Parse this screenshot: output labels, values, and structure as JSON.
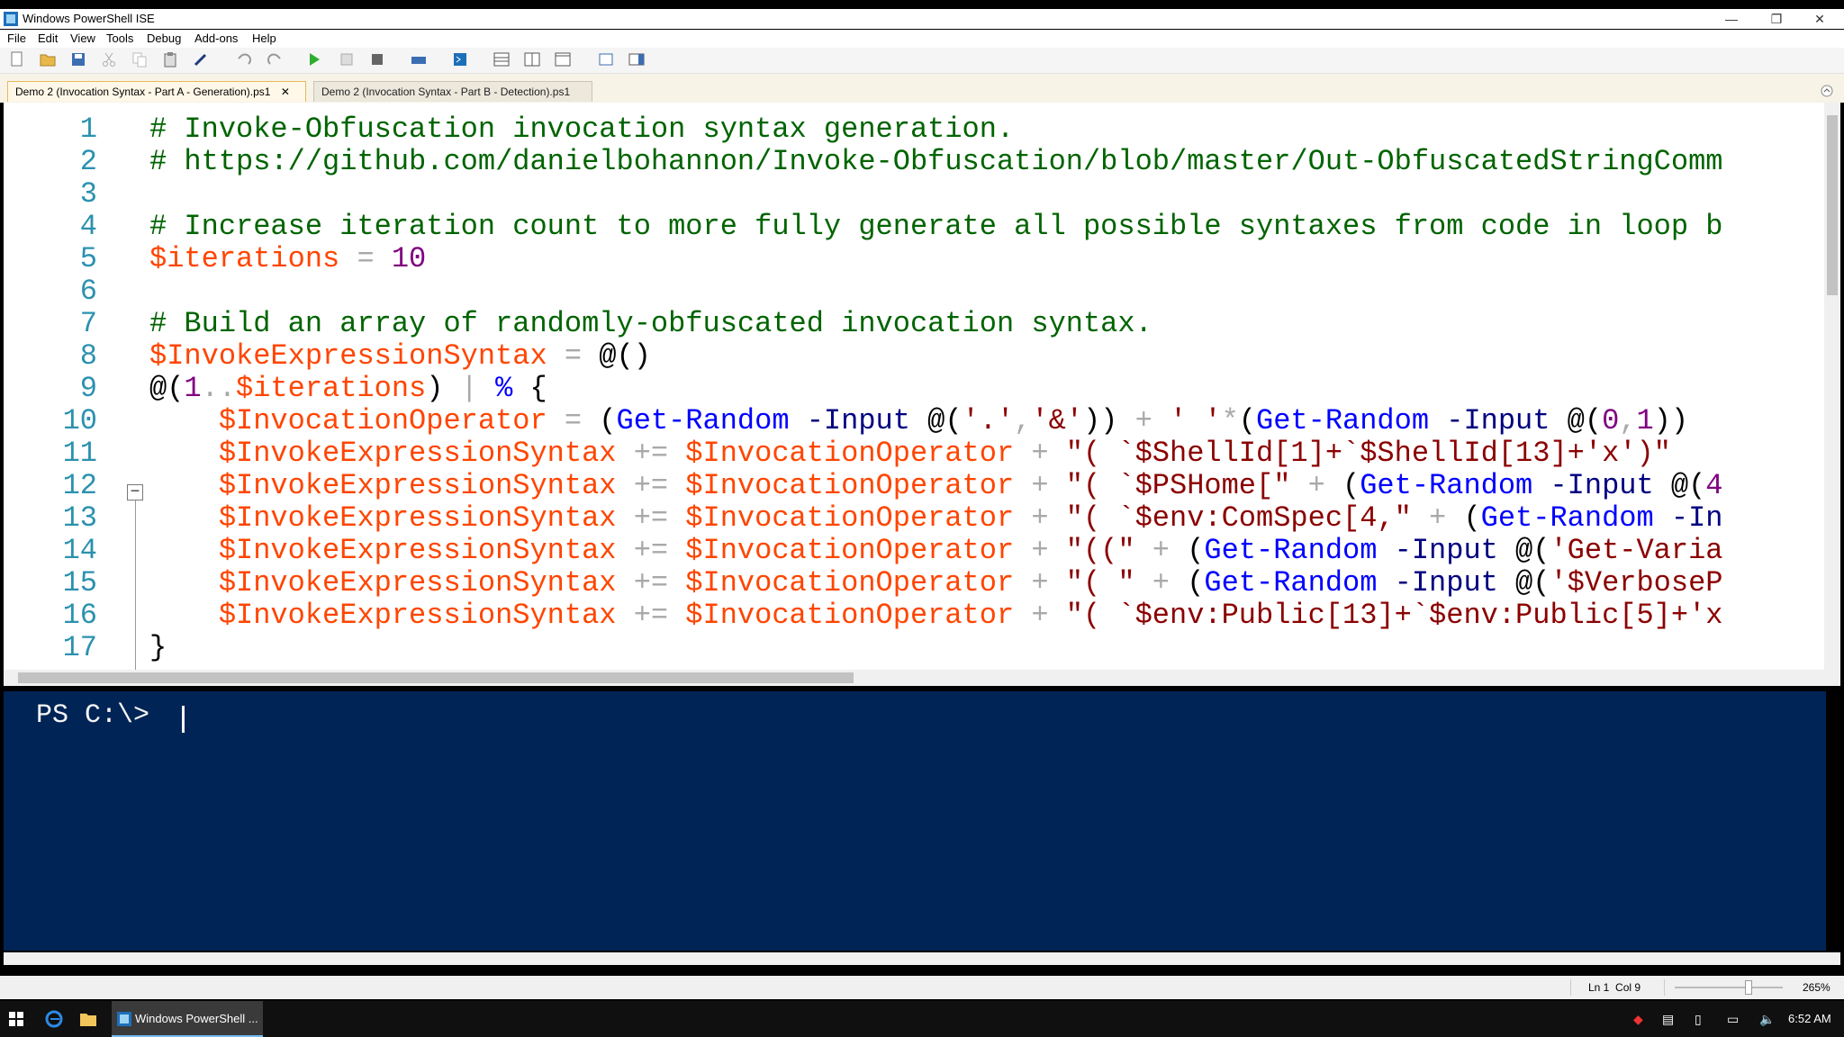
{
  "window": {
    "title": "Windows PowerShell ISE"
  },
  "menu": [
    "File",
    "Edit",
    "View",
    "Tools",
    "Debug",
    "Add-ons",
    "Help"
  ],
  "tabs": [
    {
      "label": "Demo 2 (Invocation Syntax - Part A - Generation).ps1",
      "close": "✕",
      "active": true
    },
    {
      "label": "Demo 2 (Invocation Syntax - Part B - Detection).ps1",
      "active": false
    }
  ],
  "editor": {
    "line_numbers": [
      "1",
      "2",
      "3",
      "4",
      "5",
      "6",
      "7",
      "8",
      "9",
      "10",
      "11",
      "12",
      "13",
      "14",
      "15",
      "16",
      "17"
    ],
    "lines": [
      {
        "tokens": [
          {
            "t": "# Invoke-Obfuscation invocation syntax generation.",
            "c": "cm"
          }
        ]
      },
      {
        "tokens": [
          {
            "t": "# https://github.com/danielbohannon/Invoke-Obfuscation/blob/master/Out-ObfuscatedStringComm",
            "c": "cm"
          }
        ]
      },
      {
        "tokens": []
      },
      {
        "tokens": [
          {
            "t": "# Increase iteration count to more fully generate all possible syntaxes from code in loop b",
            "c": "cm"
          }
        ]
      },
      {
        "tokens": [
          {
            "t": "$iterations",
            "c": "vr"
          },
          {
            "t": " = ",
            "c": "op"
          },
          {
            "t": "10",
            "c": "nm"
          }
        ]
      },
      {
        "tokens": []
      },
      {
        "tokens": [
          {
            "t": "# Build an array of randomly-obfuscated invocation syntax.",
            "c": "cm"
          }
        ]
      },
      {
        "tokens": [
          {
            "t": "$InvokeExpressionSyntax",
            "c": "vr"
          },
          {
            "t": " = ",
            "c": "op"
          },
          {
            "t": "@()",
            "c": ""
          }
        ]
      },
      {
        "tokens": [
          {
            "t": "@(",
            "c": ""
          },
          {
            "t": "1",
            "c": "nm"
          },
          {
            "t": "..",
            "c": "op"
          },
          {
            "t": "$iterations",
            "c": "vr"
          },
          {
            "t": ")",
            "c": ""
          },
          {
            "t": " | ",
            "c": "op"
          },
          {
            "t": "%",
            "c": "cmd"
          },
          {
            "t": " {",
            "c": ""
          }
        ]
      },
      {
        "tokens": [
          {
            "t": "    $InvocationOperator",
            "c": "vr"
          },
          {
            "t": " = ",
            "c": "op"
          },
          {
            "t": "(",
            "c": ""
          },
          {
            "t": "Get-Random",
            "c": "cmd"
          },
          {
            "t": " -Input",
            "c": "prm"
          },
          {
            "t": " @(",
            "c": ""
          },
          {
            "t": "'.'",
            "c": "str"
          },
          {
            "t": ",",
            "c": "op"
          },
          {
            "t": "'&'",
            "c": "str"
          },
          {
            "t": ")) ",
            "c": ""
          },
          {
            "t": "+ ",
            "c": "op"
          },
          {
            "t": "' '",
            "c": "str"
          },
          {
            "t": "*",
            "c": "op"
          },
          {
            "t": "(",
            "c": ""
          },
          {
            "t": "Get-Random",
            "c": "cmd"
          },
          {
            "t": " -Input",
            "c": "prm"
          },
          {
            "t": " @(",
            "c": ""
          },
          {
            "t": "0",
            "c": "nm"
          },
          {
            "t": ",",
            "c": "op"
          },
          {
            "t": "1",
            "c": "nm"
          },
          {
            "t": "))",
            "c": ""
          }
        ]
      },
      {
        "tokens": [
          {
            "t": "    $InvokeExpressionSyntax",
            "c": "vr"
          },
          {
            "t": " += ",
            "c": "op"
          },
          {
            "t": "$InvocationOperator",
            "c": "vr"
          },
          {
            "t": " + ",
            "c": "op"
          },
          {
            "t": "\"( `$ShellId[1]+`$ShellId[13]+'x')\"",
            "c": "str"
          }
        ]
      },
      {
        "tokens": [
          {
            "t": "    $InvokeExpressionSyntax",
            "c": "vr"
          },
          {
            "t": " += ",
            "c": "op"
          },
          {
            "t": "$InvocationOperator",
            "c": "vr"
          },
          {
            "t": " + ",
            "c": "op"
          },
          {
            "t": "\"( `$PSHome[\"",
            "c": "str"
          },
          {
            "t": " + ",
            "c": "op"
          },
          {
            "t": "(",
            "c": ""
          },
          {
            "t": "Get-Random",
            "c": "cmd"
          },
          {
            "t": " -Input",
            "c": "prm"
          },
          {
            "t": " @(",
            "c": ""
          },
          {
            "t": "4",
            "c": "nm"
          }
        ]
      },
      {
        "tokens": [
          {
            "t": "    $InvokeExpressionSyntax",
            "c": "vr"
          },
          {
            "t": " += ",
            "c": "op"
          },
          {
            "t": "$InvocationOperator",
            "c": "vr"
          },
          {
            "t": " + ",
            "c": "op"
          },
          {
            "t": "\"( `$env:ComSpec[4,\"",
            "c": "str"
          },
          {
            "t": " + ",
            "c": "op"
          },
          {
            "t": "(",
            "c": ""
          },
          {
            "t": "Get-Random",
            "c": "cmd"
          },
          {
            "t": " -In",
            "c": "prm"
          }
        ]
      },
      {
        "tokens": [
          {
            "t": "    $InvokeExpressionSyntax",
            "c": "vr"
          },
          {
            "t": " += ",
            "c": "op"
          },
          {
            "t": "$InvocationOperator",
            "c": "vr"
          },
          {
            "t": " + ",
            "c": "op"
          },
          {
            "t": "\"((\"",
            "c": "str"
          },
          {
            "t": " + ",
            "c": "op"
          },
          {
            "t": "(",
            "c": ""
          },
          {
            "t": "Get-Random",
            "c": "cmd"
          },
          {
            "t": " -Input",
            "c": "prm"
          },
          {
            "t": " @(",
            "c": ""
          },
          {
            "t": "'Get-Varia",
            "c": "str"
          }
        ]
      },
      {
        "tokens": [
          {
            "t": "    $InvokeExpressionSyntax",
            "c": "vr"
          },
          {
            "t": " += ",
            "c": "op"
          },
          {
            "t": "$InvocationOperator",
            "c": "vr"
          },
          {
            "t": " + ",
            "c": "op"
          },
          {
            "t": "\"( \"",
            "c": "str"
          },
          {
            "t": " + ",
            "c": "op"
          },
          {
            "t": "(",
            "c": ""
          },
          {
            "t": "Get-Random",
            "c": "cmd"
          },
          {
            "t": " -Input",
            "c": "prm"
          },
          {
            "t": " @(",
            "c": ""
          },
          {
            "t": "'$VerboseP",
            "c": "str"
          }
        ]
      },
      {
        "tokens": [
          {
            "t": "    $InvokeExpressionSyntax",
            "c": "vr"
          },
          {
            "t": " += ",
            "c": "op"
          },
          {
            "t": "$InvocationOperator",
            "c": "vr"
          },
          {
            "t": " + ",
            "c": "op"
          },
          {
            "t": "\"( `$env:Public[13]+`$env:Public[5]+'x",
            "c": "str"
          }
        ]
      },
      {
        "tokens": [
          {
            "t": "}",
            "c": ""
          }
        ]
      }
    ]
  },
  "console": {
    "prompt": "PS C:\\> "
  },
  "status": {
    "position": "Ln 1  Col 9",
    "zoom": "265%"
  },
  "taskbar": {
    "app_label": "Windows PowerShell ...",
    "time": "6:52 AM"
  }
}
